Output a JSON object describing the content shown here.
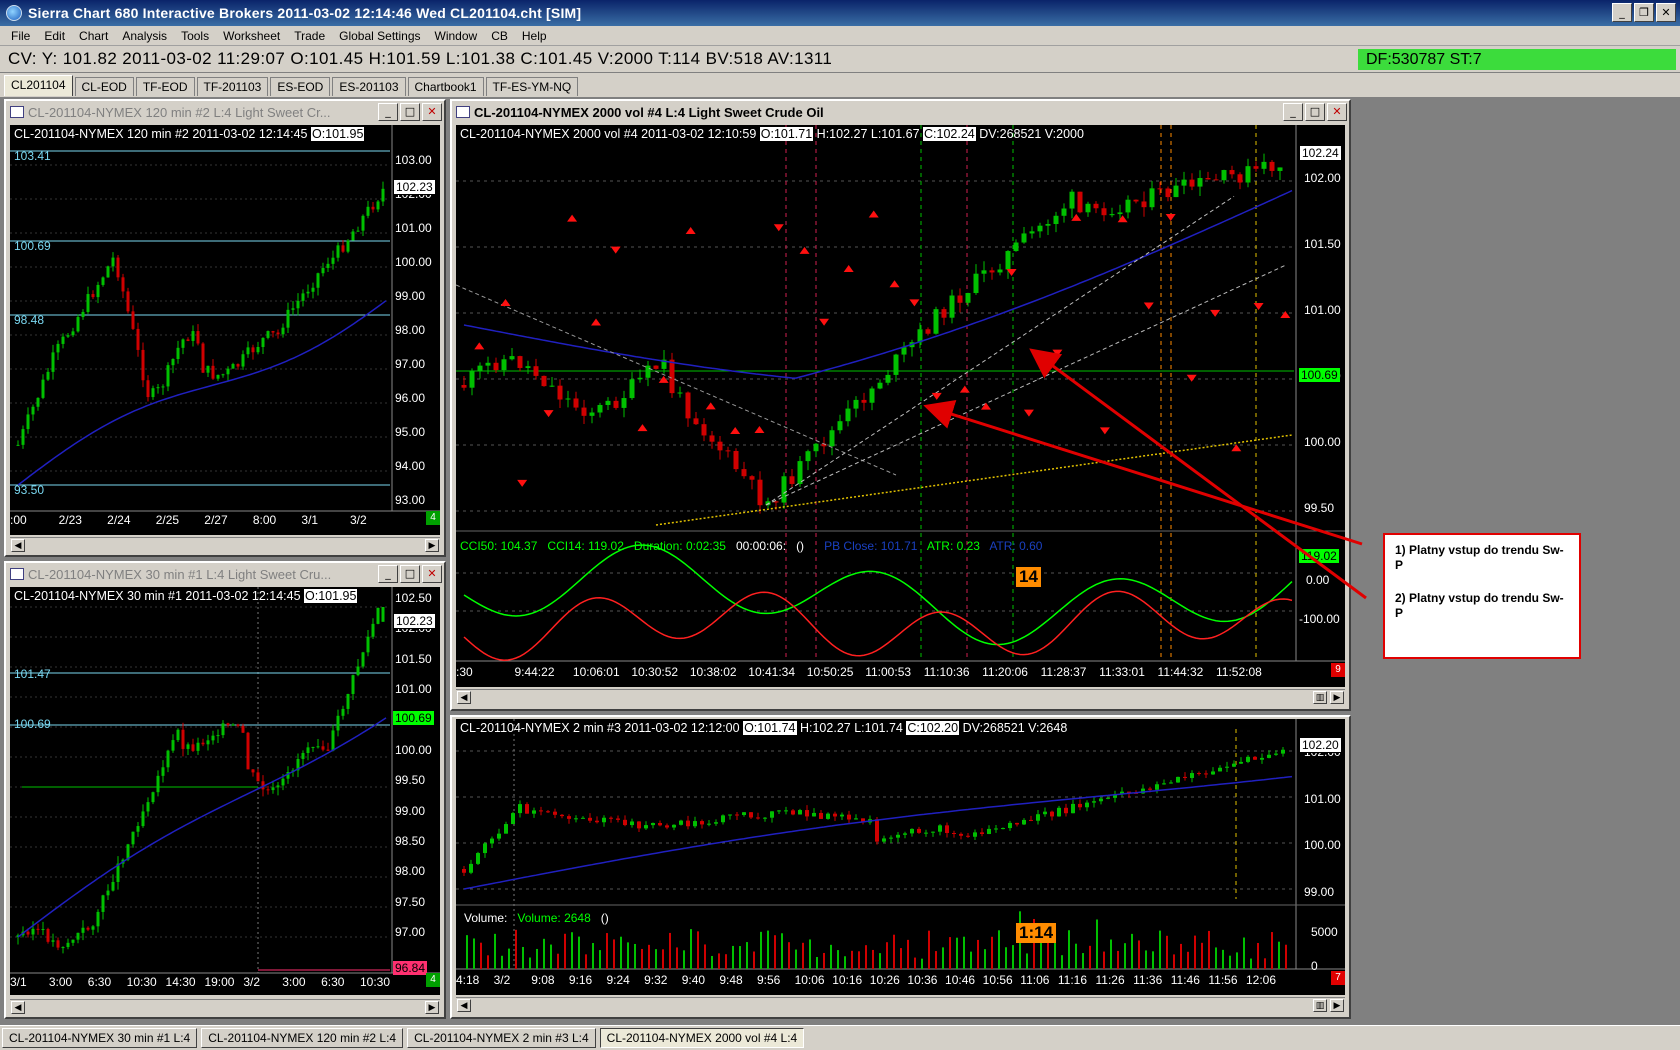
{
  "window": {
    "title": "Sierra Chart 680 Interactive Brokers 2011-03-02  12:14:46  Wed    CL201104.cht [SIM]",
    "buttons": [
      "_",
      "❐",
      "✕"
    ]
  },
  "menu": [
    "File",
    "Edit",
    "Chart",
    "Analysis",
    "Tools",
    "Worksheet",
    "Trade",
    "Global Settings",
    "Window",
    "CB",
    "Help"
  ],
  "info": {
    "text": "CV: Y: 101.82  2011-03-02  11:29:07  O:101.45  H:101.59  L:101.38  C:101.45  V:2000  T:114  BV:518  AV:1311",
    "df": "DF:530787  ST:7"
  },
  "chartbook_tabs": [
    "CL201104",
    "CL-EOD",
    "TF-EOD",
    "TF-201103",
    "ES-EOD",
    "ES-201103",
    "Chartbook1",
    "TF-ES-YM-NQ"
  ],
  "charts": {
    "c120": {
      "title": "CL-201104-NYMEX  120 min   #2  L:4  Light Sweet Cr...",
      "header": "CL-201104-NYMEX  120 min   #2 2011-03-02 12:14:45",
      "open_box": "O:101.95",
      "price_axis": [
        "103.00",
        "102.00",
        "101.00",
        "100.00",
        "99.00",
        "98.00",
        "97.00",
        "96.00",
        "95.00",
        "94.00",
        "93.00"
      ],
      "last_price": "102.23",
      "levels": [
        "103.41",
        "100.69",
        "98.48",
        "93.50"
      ],
      "time_axis": [
        ":00",
        "2/23",
        "2/24",
        "2/25",
        "2/27",
        "8:00",
        "3/1",
        "3/2"
      ],
      "badge": "4"
    },
    "c30": {
      "title": "CL-201104-NYMEX  30 min   #1  L:4  Light Sweet Cru...",
      "header": "CL-201104-NYMEX  30 min   #1 2011-03-02 12:14:45",
      "open_box": "O:101.95",
      "price_axis": [
        "102.50",
        "102.00",
        "101.50",
        "101.00",
        "100.50",
        "100.00",
        "99.50",
        "99.00",
        "98.50",
        "98.00",
        "97.50",
        "97.00"
      ],
      "last_price": "102.23",
      "green_price": "100.69",
      "red_price": "96.84",
      "levels": [
        "101.47",
        "100.69"
      ],
      "time_axis": [
        "3/1",
        "3:00",
        "6:30",
        "10:30",
        "14:30",
        "19:00",
        "3/2",
        "3:00",
        "6:30",
        "10:30"
      ],
      "badge": "4"
    },
    "c2000": {
      "title": "CL-201104-NYMEX  2000 vol  #4  L:4  Light Sweet Crude Oil",
      "header": "CL-201104-NYMEX  2000 vol  #4 2011-03-02 12:10:59",
      "open_box": "O:101.71",
      "header_rest1": "H:102.27  L:101.67",
      "close_box": "C:102.24",
      "header_rest2": "DV:268521  V:2000",
      "price_axis": [
        "102.00",
        "101.50",
        "101.00",
        "100.50",
        "100.00",
        "99.50"
      ],
      "last_price": "102.24",
      "green_price": "100.69",
      "indicator": {
        "cci50": "CCI50: 104.37",
        "cci14": "CCI14: 119.02",
        "duration": "Duration: 0:02:35",
        "timer": "00:00:06:",
        "paren": "()",
        "pb": "PB Close: 101.71",
        "atr1": "ATR: 0.23",
        "atr2": "ATR: 0.60",
        "axis": [
          "0.00",
          "-100.00"
        ],
        "last": "119.02",
        "badge_text": "14"
      },
      "time_axis": [
        ":30",
        "9:44:22",
        "10:06:01",
        "10:30:52",
        "10:38:02",
        "10:41:34",
        "10:50:25",
        "11:00:53",
        "11:10:36",
        "11:20:06",
        "11:28:37",
        "11:33:01",
        "11:44:32",
        "11:52:08"
      ],
      "badge": "9"
    },
    "c2min": {
      "header": "CL-201104-NYMEX  2 min   #3 2011-03-02 12:12:00",
      "open_box": "O:101.74",
      "header_rest1": "H:102.27  L:101.74",
      "close_box": "C:102.20",
      "header_rest2": "DV:268521  V:2648",
      "price_axis": [
        "102.00",
        "101.00",
        "100.00",
        "99.00"
      ],
      "last_price": "102.20",
      "volume_label": "Volume:",
      "volume_value": "Volume: 2648",
      "volume_paren": "()",
      "volume_axis": [
        "5000",
        "0"
      ],
      "badge_text": "1:14",
      "time_axis": [
        "4:18",
        "3/2",
        "9:08",
        "9:16",
        "9:24",
        "9:32",
        "9:40",
        "9:48",
        "9:56",
        "10:06",
        "10:16",
        "10:26",
        "10:36",
        "10:46",
        "10:56",
        "11:06",
        "11:16",
        "11:26",
        "11:36",
        "11:46",
        "11:56",
        "12:06"
      ],
      "badge": "7"
    }
  },
  "annotation": {
    "line1": "1) Platny vstup do trendu Sw-P",
    "line2": "2) Platny vstup do trendu Sw-P"
  },
  "taskbar": [
    "CL-201104-NYMEX 30 min  #1  L:4",
    "CL-201104-NYMEX 120 min  #2  L:4",
    "CL-201104-NYMEX 2 min  #3  L:4",
    "CL-201104-NYMEX 2000 vol  #4  L:4"
  ],
  "colors": {
    "up_candle": "#00c000",
    "down_candle": "#d00000",
    "level_line": "#7ad7f0",
    "ma_line": "#2020c0",
    "annotation_arrow": "#e00000",
    "info_green": "#3cdc3c"
  }
}
